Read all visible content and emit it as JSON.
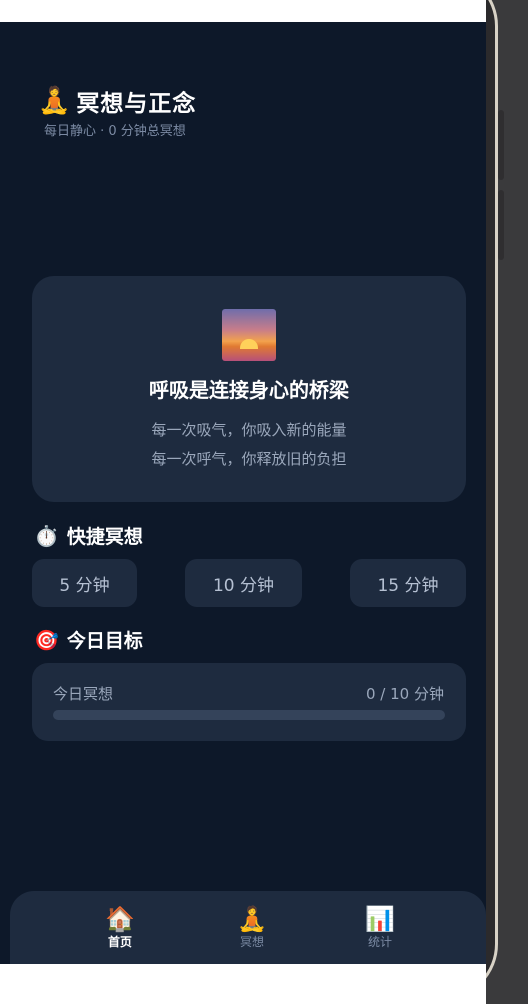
{
  "header": {
    "emoji": "🧘",
    "title": "冥想与正念",
    "subtitle": "每日静心 · 0 分钟总冥想"
  },
  "hero": {
    "image": "sunset-icon",
    "title": "呼吸是连接身心的桥梁",
    "line1": "每一次吸气，你吸入新的能量",
    "line2": "每一次呼气，你释放旧的负担"
  },
  "quick": {
    "emoji": "⏱️",
    "title": "快捷冥想",
    "buttons": [
      "5 分钟",
      "10 分钟",
      "15 分钟"
    ]
  },
  "goal": {
    "emoji": "🎯",
    "title": "今日目标",
    "label": "今日冥想",
    "value": "0 / 10 分钟",
    "progress": 0
  },
  "tabs": [
    {
      "emoji": "🏠",
      "label": "首页",
      "active": true
    },
    {
      "emoji": "🧘",
      "label": "冥想",
      "active": false
    },
    {
      "emoji": "📊",
      "label": "统计",
      "active": false
    }
  ]
}
